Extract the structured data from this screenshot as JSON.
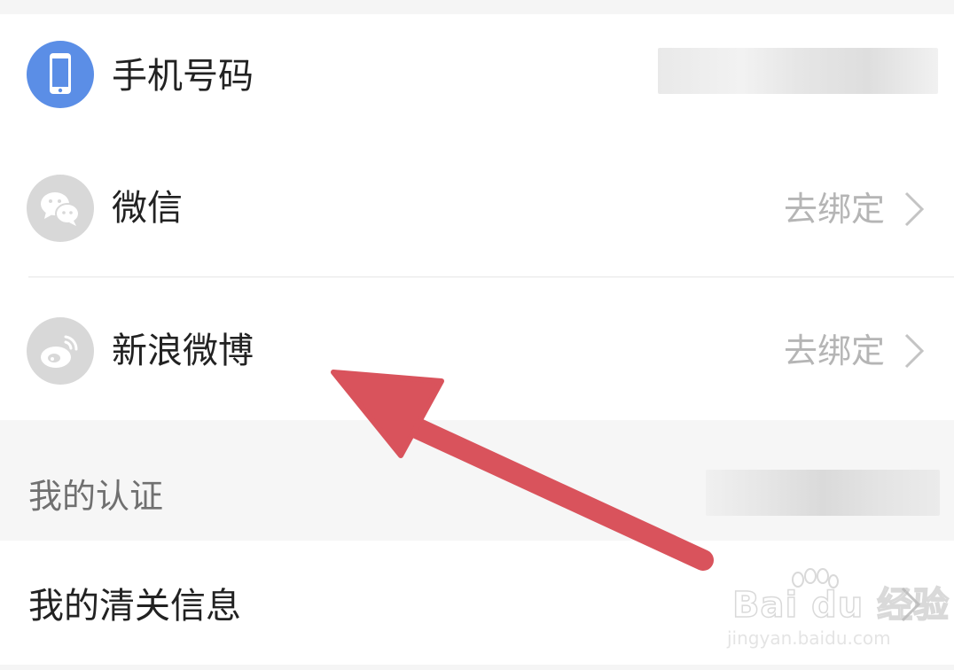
{
  "accounts": {
    "phone": {
      "label": "手机号码",
      "icon": "phone-icon"
    },
    "wechat": {
      "label": "微信",
      "action": "去绑定",
      "icon": "wechat-icon"
    },
    "weibo": {
      "label": "新浪微博",
      "action": "去绑定",
      "icon": "weibo-icon"
    }
  },
  "certification": {
    "title": "我的认证",
    "customs_info_label": "我的清关信息"
  },
  "watermark": {
    "main": "Bai du 经验",
    "sub": "jingyan.baidu.com"
  },
  "colors": {
    "phone_icon_bg": "#5b8ee6",
    "social_icon_bg": "#d8d8d8",
    "arrow": "#d9535c",
    "action_text": "#b5b5b5"
  }
}
